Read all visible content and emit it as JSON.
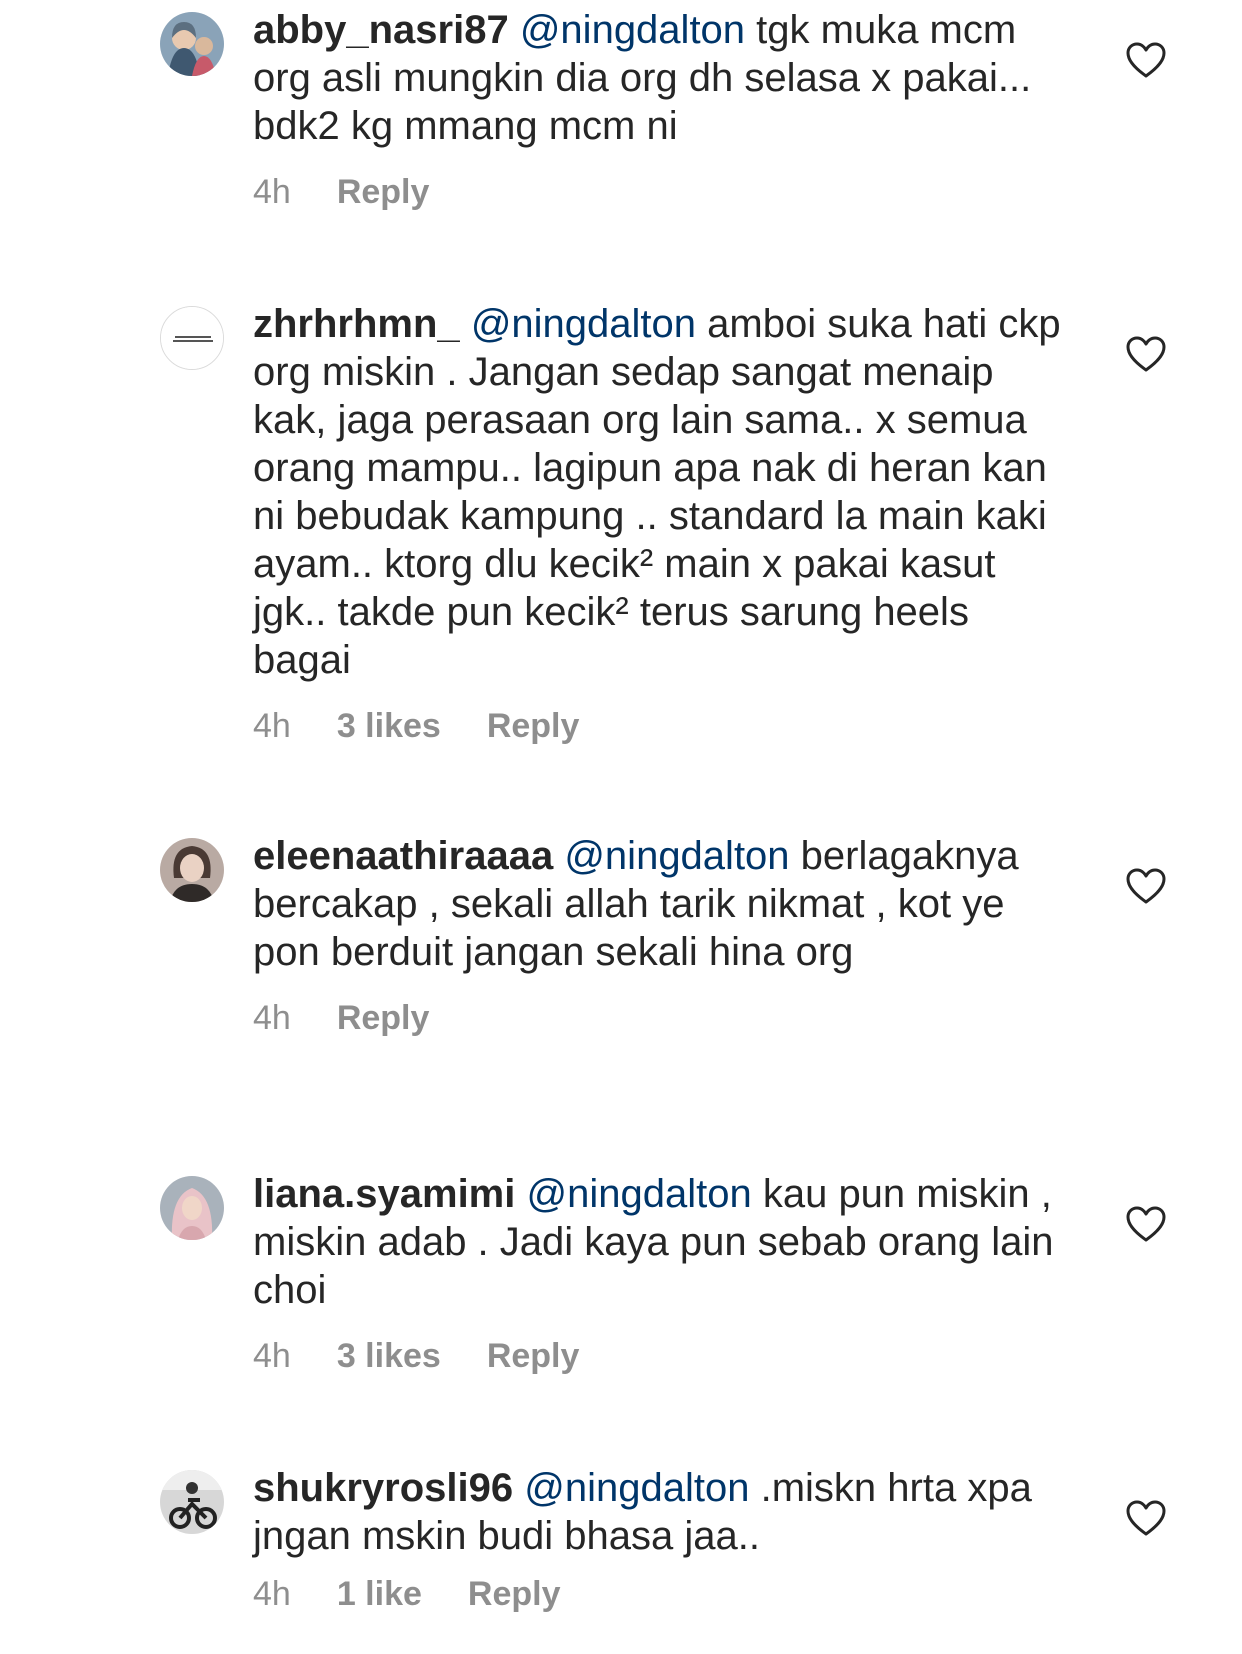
{
  "comments": [
    {
      "username": "abby_nasri87",
      "mention": "@ningdalton",
      "text": " tgk muka mcm org asli mungkin dia org dh selasa x pakai... bdk2 kg mmang mcm ni",
      "time": "4h",
      "likes": "",
      "reply": "Reply"
    },
    {
      "username": "zhrhrhmn_",
      "mention": "@ningdalton",
      "text": " amboi suka hati ckp org miskin . Jangan sedap sangat menaip kak, jaga perasaan org lain sama.. x semua orang mampu.. lagipun apa nak di heran kan ni bebudak kampung .. standard la main kaki ayam.. ktorg dlu kecik² main x pakai kasut jgk.. takde pun kecik² terus sarung heels bagai",
      "time": "4h",
      "likes": "3 likes",
      "reply": "Reply"
    },
    {
      "username": "eleenaathiraaaa",
      "mention": "@ningdalton",
      "text": " berlagaknya bercakap , sekali allah tarik nikmat , kot ye pon berduit jangan sekali hina org",
      "time": "4h",
      "likes": "",
      "reply": "Reply"
    },
    {
      "username": "liana.syamimi",
      "mention": "@ningdalton",
      "text": " kau pun miskin , miskin adab . Jadi kaya pun sebab orang lain choi",
      "time": "4h",
      "likes": "3 likes",
      "reply": "Reply"
    },
    {
      "username": "shukryrosli96",
      "mention": "@ningdalton",
      "text": " .miskn hrta xpa jngan mskin budi bhasa jaa..",
      "time": "4h",
      "likes": "1 like",
      "reply": "Reply"
    }
  ],
  "colors": {
    "text": "#262626",
    "mention": "#003569",
    "meta": "#8e8e8e",
    "heart": "#262626"
  },
  "icons": {
    "like": "heart-outline-icon",
    "avatar": "profile-avatar"
  }
}
